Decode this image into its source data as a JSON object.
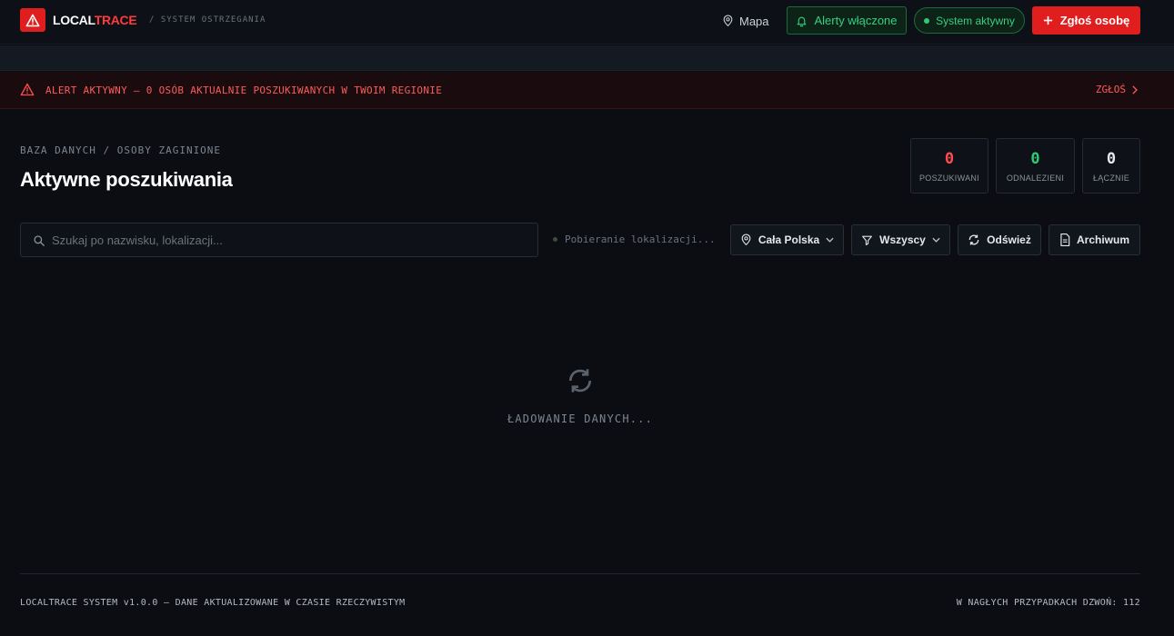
{
  "header": {
    "brand_part1": "LOCAL",
    "brand_part2": "TRACE",
    "brand_subtitle": "/ SYSTEM OSTRZEGANIA",
    "map_label": "Mapa",
    "alerts_label": "Alerty włączone",
    "system_label": "System aktywny",
    "report_label": "Zgłoś osobę"
  },
  "alert": {
    "text": "ALERT AKTYWNY — 0 OSÓB AKTUALNIE POSZUKIWANYCH W TWOIM REGIONIE",
    "link": "ZGŁOŚ"
  },
  "main": {
    "breadcrumb": "BAZA DANYCH / OSOBY ZAGINIONE",
    "title": "Aktywne poszukiwania"
  },
  "stats": [
    {
      "value": "0",
      "label": "POSZUKIWANI",
      "color": "#ff4d4d"
    },
    {
      "value": "0",
      "label": "ODNALEZIENI",
      "color": "#2ecc71"
    },
    {
      "value": "0",
      "label": "ŁĄCZNIE",
      "color": "#e6e8ec"
    }
  ],
  "toolbar": {
    "search_placeholder": "Szukaj po nazwisku, lokalizacji...",
    "location_status": "Pobieranie lokalizacji...",
    "region_label": "Cała Polska",
    "filter_label": "Wszyscy",
    "refresh_label": "Odśwież",
    "archive_label": "Archiwum"
  },
  "loading": {
    "text": "ŁADOWANIE DANYCH..."
  },
  "footer": {
    "left": "LOCALTRACE SYSTEM v1.0.0 — DANE AKTUALIZOWANE W CZASIE RZECZYWISTYM",
    "right": "W NAGŁYCH PRZYPADKACH DZWOŃ: 112"
  },
  "colors": {
    "accent_red": "#e01e1e",
    "accent_green": "#2ecc71",
    "background": "#0b0d12"
  }
}
